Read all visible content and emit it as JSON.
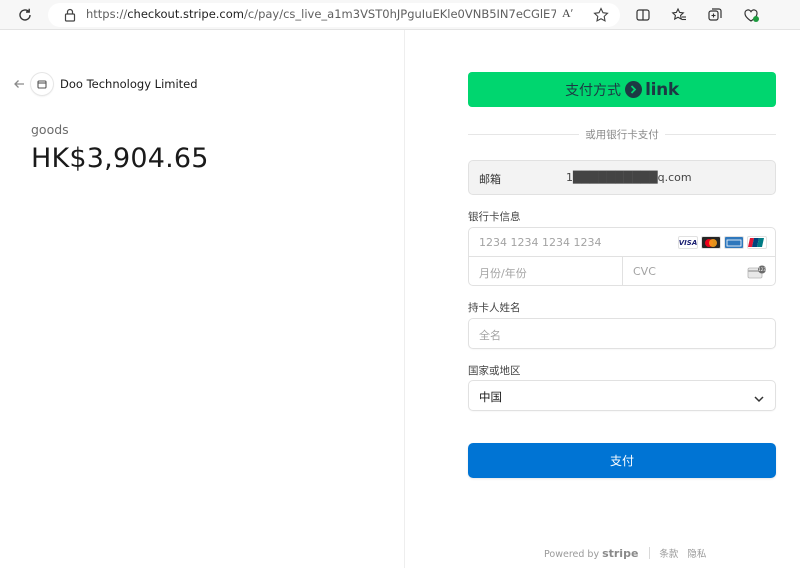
{
  "browser": {
    "url_prefix": "https://",
    "url_host": "checkout.stripe.com",
    "url_path": "/c/pay/cs_live_a1m3VST0hJPguIuEKle0VNB5IN7eCGlE7nLi3kAE...",
    "reader_label": "Aʹ"
  },
  "merchant": {
    "name": "Doo Technology Limited"
  },
  "order": {
    "product": "goods",
    "amount": "HK$3,904.65"
  },
  "link_button": {
    "label": "支付方式",
    "brand": "link"
  },
  "divider_text": "或用银行卡支付",
  "email": {
    "label": "邮箱",
    "value": "1██████████q.com"
  },
  "card": {
    "label": "银行卡信息",
    "number_placeholder": "1234 1234 1234 1234",
    "expiry_placeholder": "月份/年份",
    "cvc_placeholder": "CVC",
    "brands": [
      "VISA",
      "MC",
      "AMEX",
      "UP"
    ]
  },
  "cardholder": {
    "label": "持卡人姓名",
    "placeholder": "全名"
  },
  "country": {
    "label": "国家或地区",
    "value": "中国"
  },
  "pay_button": {
    "label": "支付"
  },
  "footer": {
    "powered_by": "Powered by",
    "brand": "stripe",
    "terms": "条款",
    "privacy": "隐私"
  },
  "colors": {
    "link_green": "#00d66f",
    "pay_blue": "#0074d4"
  }
}
